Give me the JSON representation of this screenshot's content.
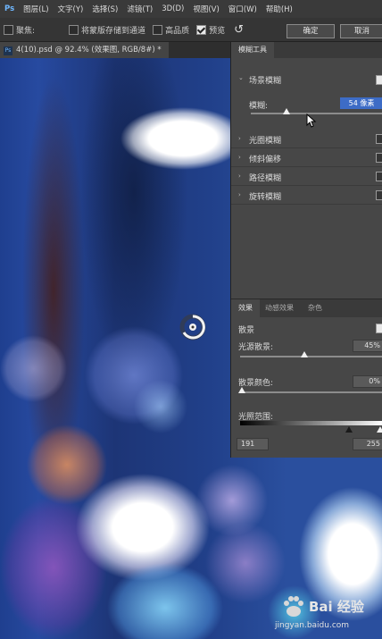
{
  "menubar": {
    "items": [
      "Ps",
      "图层(L)",
      "文字(Y)",
      "选择(S)",
      "滤镜(T)",
      "3D(D)",
      "视图(V)",
      "窗口(W)",
      "帮助(H)"
    ]
  },
  "options": {
    "gather_label": "聚焦:",
    "save_mask_label": "将蒙版存储到通道",
    "high_quality_label": "高品质",
    "preview_label": "预览",
    "ok_label": "确定",
    "cancel_label": "取消"
  },
  "document": {
    "tab_label": "4(10).psd @ 92.4% (效果图, RGB/8#) *"
  },
  "blur_tools": {
    "panel_title": "模糊工具",
    "field_blur_label": "场景模糊",
    "blur_label": "模糊:",
    "blur_value": "54 像素",
    "blur_slider_fraction": 0.27,
    "iris_blur_label": "光圈模糊",
    "tilt_shift_label": "倾斜偏移",
    "path_blur_label": "路径模糊",
    "spin_blur_label": "旋转模糊"
  },
  "effects": {
    "tabs": [
      "效果",
      "动感效果",
      "杂色"
    ],
    "bokeh_label": "散景",
    "light_bokeh_label": "光源散景:",
    "light_bokeh_value": "45%",
    "light_bokeh_fraction": 0.45,
    "bokeh_color_label": "散景颜色:",
    "bokeh_color_value": "0%",
    "bokeh_color_fraction": 0.0,
    "light_range_label": "光照范围:",
    "range_low": "191",
    "range_high": "255"
  },
  "watermark": {
    "text": "Bai 经验",
    "url": "jingyan.baidu.com"
  },
  "colors": {
    "accent_selection": "#3d6cc6",
    "panel_bg": "#474747"
  }
}
